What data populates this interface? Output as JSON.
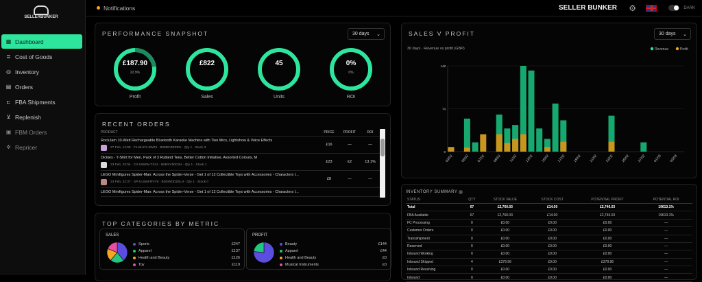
{
  "logo": {
    "text": "SELLERBUNKER"
  },
  "sidebar": {
    "items": [
      {
        "label": "Dashboard",
        "icon": "grid-icon",
        "active": true
      },
      {
        "label": "Cost of Goods",
        "icon": "coins-icon"
      },
      {
        "label": "Inventory",
        "icon": "box-icon"
      },
      {
        "label": "Orders",
        "icon": "clipboard-icon"
      },
      {
        "label": "FBA Shipments",
        "icon": "truck-icon"
      },
      {
        "label": "Replenish",
        "icon": "chart-icon"
      },
      {
        "label": "FBM Orders",
        "icon": "package-icon",
        "dim": true
      },
      {
        "label": "Repricer",
        "icon": "gear-icon",
        "dim": true
      }
    ]
  },
  "topbar": {
    "notifications": "Notifications",
    "brand": "SELLER BUNKER",
    "theme_label": "DARK",
    "accent": "#2ee59d"
  },
  "performance": {
    "title": "PERFORMANCE SNAPSHOT",
    "range": "30 days",
    "metrics": [
      {
        "label": "Profit",
        "value": "£187.90",
        "sub": "22.9%",
        "fill": 0.229
      },
      {
        "label": "Sales",
        "value": "£822",
        "sub": ""
      },
      {
        "label": "Units",
        "value": "45",
        "sub": ""
      },
      {
        "label": "ROI",
        "value": "0%",
        "sub": "0%"
      }
    ]
  },
  "orders": {
    "title": "RECENT ORDERS",
    "columns": [
      "PRODUCT",
      "PRICE",
      "PROFIT",
      "ROI"
    ],
    "rows": [
      {
        "title": "RockJam 10-Watt Rechargeable Bluetooth Karaoke Machine with Two Mics, Lightshow & Voice Effects",
        "meta": "27 Feb, 14:08 · F1-BHC2-9W03 · B09BCBZZRU · Qty 1 · Stock 3",
        "price": "£16",
        "profit": "—",
        "roi": "—"
      },
      {
        "title": "Dickies - T-Shirt for Men, Pack of 3 Rutland Tees, Better Cotton Initiative, Assorted Colours, M",
        "meta": "23 Feb, 23:04 · C0-U9WW-TX24 · B0BSY50C8H · Qty 1 · Stock 1",
        "price": "£23",
        "profit": "£2",
        "roi": "13.1%"
      },
      {
        "title": "LEGO Minifigures Spider-Man: Across the Spider-Verse - Get 1 of 12 Collectible Toys with Accessories - Characters I...",
        "meta": "23 Feb, 22:37 · SP-UUUM-RVY8 · B0DWDDZ8LH · Qty 1 · Stock 0",
        "price": "£8",
        "profit": "—",
        "roi": "—"
      },
      {
        "title": "LEGO Minifigures Spider-Man: Across the Spider-Verse - Get 1 of 12 Collectible Toys with Accessories - Characters I...",
        "meta": "",
        "price": "",
        "profit": "",
        "roi": ""
      }
    ]
  },
  "categories": {
    "title": "TOP CATEGORIES BY METRIC",
    "groups": [
      {
        "label": "SALES",
        "items": [
          {
            "name": "Sports",
            "value": "£247",
            "color": "#5b4de0"
          },
          {
            "name": "Apparel",
            "value": "£137",
            "color": "#22c77f"
          },
          {
            "name": "Health and Beauty",
            "value": "£126",
            "color": "#f5a524"
          },
          {
            "name": "Toy",
            "value": "£119",
            "color": "#e84fa0"
          }
        ],
        "amounts": [
          247,
          137,
          126,
          119
        ]
      },
      {
        "label": "PROFIT",
        "items": [
          {
            "name": "Beauty",
            "value": "£144",
            "color": "#5b4de0"
          },
          {
            "name": "Apparel",
            "value": "£44",
            "color": "#22c77f"
          },
          {
            "name": "Health and Beauty",
            "value": "£0",
            "color": "#f5a524"
          },
          {
            "name": "Musical Instruments",
            "value": "£0",
            "color": "#e84fa0"
          }
        ],
        "amounts": [
          144,
          44,
          0,
          0
        ]
      }
    ]
  },
  "sales_profit": {
    "title": "SALES V PROFIT",
    "range": "30 days",
    "subtitle": "30 days · Revenue vs profit (GBP)"
  },
  "chart_data": {
    "type": "bar",
    "stacked": false,
    "legend": "top-right",
    "grid": true,
    "categories": [
      "03/02",
      "04/02",
      "05/02",
      "06/02",
      "07/02",
      "08/02",
      "09/02",
      "10/02",
      "11/02",
      "12/02",
      "13/02",
      "14/02",
      "15/02",
      "16/02",
      "17/02",
      "18/02",
      "19/02",
      "20/02",
      "21/02",
      "22/02",
      "23/02",
      "24/02",
      "25/02",
      "26/02",
      "27/02",
      "28/02",
      "01/03",
      "02/03",
      "03/03"
    ],
    "tick_labels": [
      "03/02",
      "05/02",
      "07/02",
      "09/02",
      "11/02",
      "13/02",
      "15/02",
      "17/02",
      "19/02",
      "21/02",
      "23/02",
      "25/02",
      "27/02",
      "01/03",
      "03/03"
    ],
    "yticks": [
      "0",
      "74",
      "148"
    ],
    "ylim": [
      0,
      148
    ],
    "series": [
      {
        "name": "Revenue",
        "color": "#17a870",
        "values": [
          0,
          0,
          57,
          16,
          0,
          0,
          64,
          40,
          46,
          148,
          140,
          40,
          22,
          83,
          54,
          0,
          0,
          0,
          0,
          0,
          62,
          0,
          0,
          0,
          16,
          0,
          0,
          0,
          0
        ]
      },
      {
        "name": "Profit",
        "color": "#c8961e",
        "values": [
          8,
          0,
          7,
          0,
          30,
          0,
          30,
          15,
          22,
          30,
          0,
          0,
          8,
          0,
          17,
          0,
          0,
          0,
          0,
          0,
          17,
          0,
          0,
          0,
          0,
          0,
          0,
          0,
          0
        ]
      }
    ]
  },
  "inventory": {
    "title": "INVENTORY SUMMARY",
    "columns": [
      "STATUS",
      "QTY",
      "STOCK VALUE",
      "STOCK COST",
      "POTENTIAL PROFIT",
      "POTENTIAL ROI"
    ],
    "rows": [
      [
        "Total",
        "67",
        "£2,760.03",
        "£14.00",
        "£2,746.03",
        "19613.1%"
      ],
      [
        "FBA Available",
        "67",
        "£2,760.03",
        "£14.00",
        "£2,746.03",
        "19613.1%"
      ],
      [
        "FC Processing",
        "0",
        "£0.00",
        "£0.00",
        "£0.00",
        "—"
      ],
      [
        "Customer Orders",
        "0",
        "£0.00",
        "£0.00",
        "£0.00",
        "—"
      ],
      [
        "Transshipment",
        "0",
        "£0.00",
        "£0.00",
        "£0.00",
        "—"
      ],
      [
        "Reserved",
        "0",
        "£0.00",
        "£0.00",
        "£0.00",
        "—"
      ],
      [
        "Inbound Working",
        "0",
        "£0.00",
        "£0.00",
        "£0.00",
        "—"
      ],
      [
        "Inbound Shipped",
        "4",
        "£379.96",
        "£0.00",
        "£379.96",
        "—"
      ],
      [
        "Inbound Receiving",
        "0",
        "£0.00",
        "£0.00",
        "£0.00",
        "—"
      ],
      [
        "Inbound",
        "0",
        "£0.00",
        "£0.00",
        "£0.00",
        "—"
      ]
    ]
  }
}
